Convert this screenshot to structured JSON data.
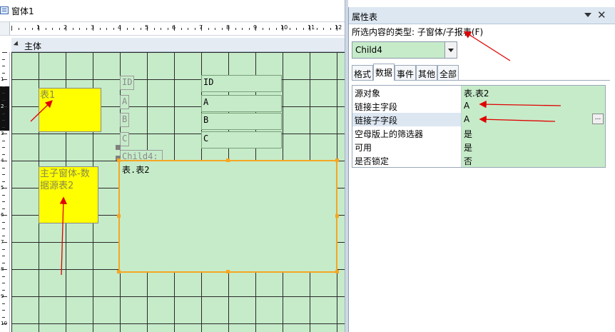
{
  "window": {
    "title": "窗体1"
  },
  "section": {
    "label": "主体"
  },
  "ruler": {
    "h_numbers": [
      "1",
      "2",
      "3",
      "4",
      "5",
      "6",
      "7",
      "8",
      "9",
      "10",
      "11",
      "12"
    ],
    "v_numbers": [
      "1",
      "2",
      "3",
      "4",
      "5",
      "6",
      "7",
      "8",
      "9",
      "10"
    ]
  },
  "form": {
    "label_table1": "表1",
    "label_main": "主子窗体-数据源表2",
    "gray_labels": [
      "ID",
      "A",
      "B",
      "C"
    ],
    "field_boxes": [
      "ID",
      "A",
      "B",
      "C"
    ],
    "subform_label": "Child4:",
    "subform_source": "表.表2"
  },
  "property_sheet": {
    "title": "属性表",
    "selection_type": "所选内容的类型: 子窗体/子报表(F)",
    "selected_object": "Child4",
    "tabs": [
      "格式",
      "数据",
      "事件",
      "其他",
      "全部"
    ],
    "active_tab": "数据",
    "rows": [
      {
        "name": "源对象",
        "value": "表.表2"
      },
      {
        "name": "链接主字段",
        "value": "A"
      },
      {
        "name": "链接子字段",
        "value": "A"
      },
      {
        "name": "空母版上的筛选器",
        "value": "是"
      },
      {
        "name": "可用",
        "value": "是"
      },
      {
        "name": "是否锁定",
        "value": "否"
      }
    ],
    "ellipsis": "..."
  },
  "colors": {
    "grid_bg": "#c6ebc9",
    "label_yellow": "#ffff00",
    "subform_border": "#f5a623",
    "annotation_red": "#e00000"
  },
  "icons": [
    "form-icon",
    "section-collapse-icon",
    "pin-icon",
    "close-icon",
    "dropdown-arrow-icon",
    "ellipsis-icon"
  ]
}
